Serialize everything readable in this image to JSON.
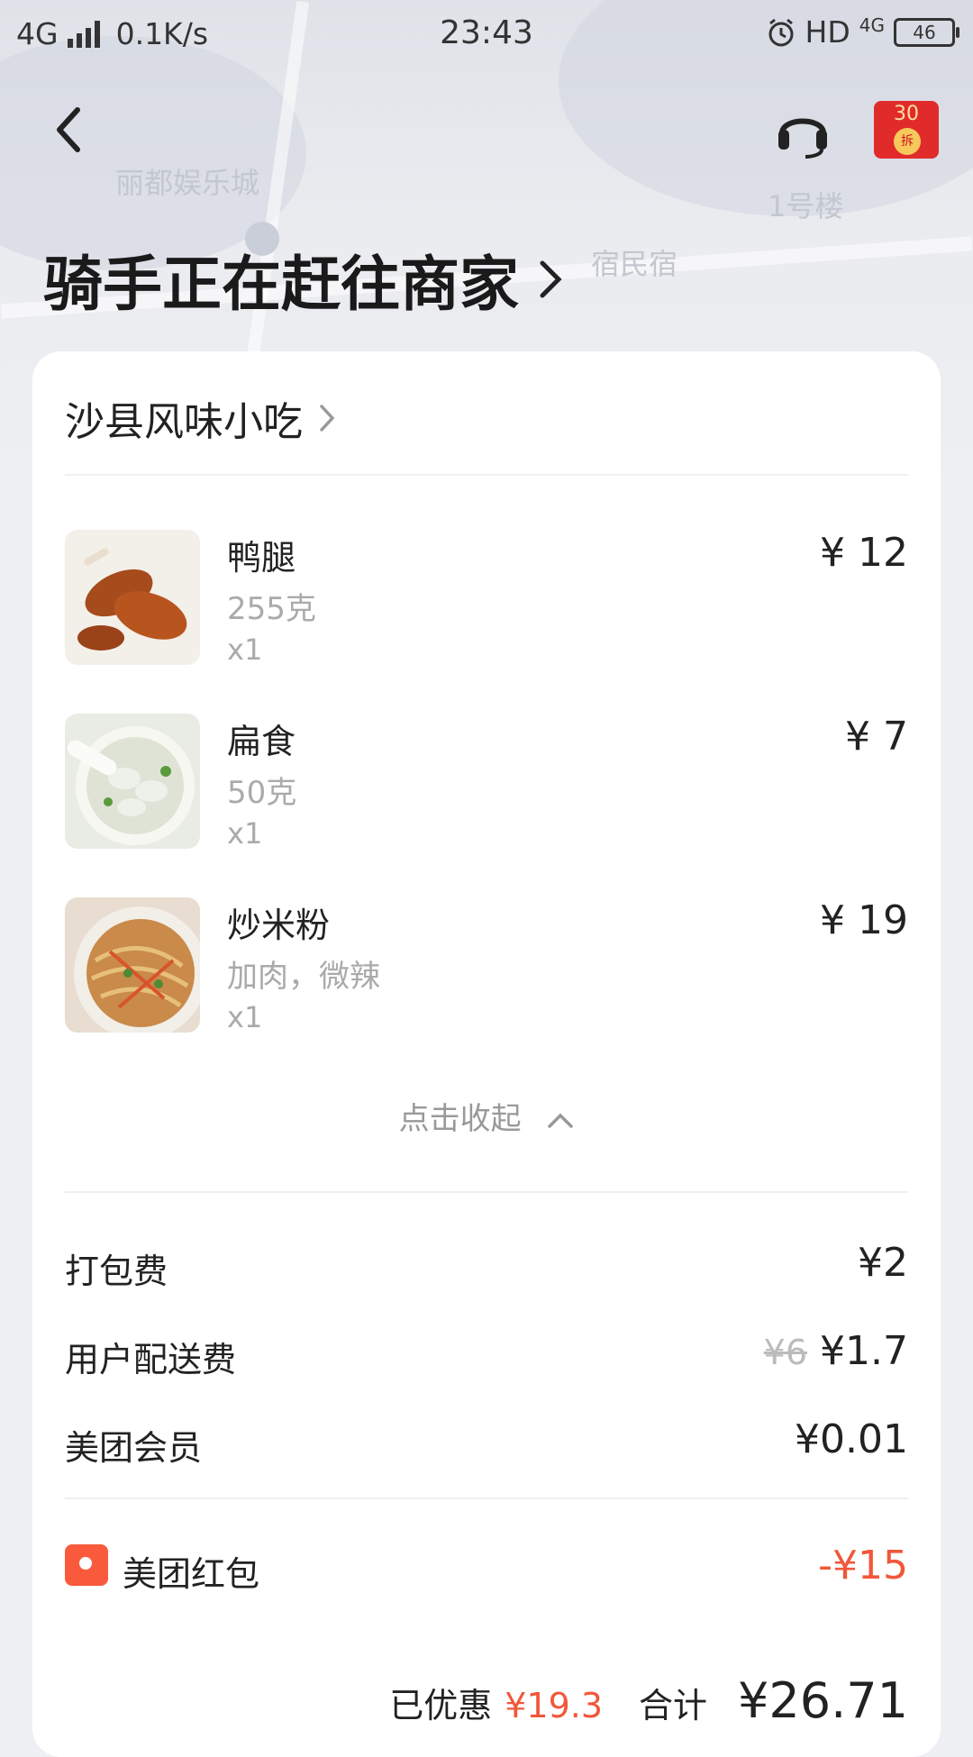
{
  "status_bar": {
    "network": "4G",
    "speed": "0.1K/s",
    "time": "23:43",
    "hd": "HD",
    "net_right": "4G",
    "battery": "46"
  },
  "header": {
    "back_icon": "chevron-left-icon",
    "service_icon": "headset-icon",
    "redpacket_amount": "30",
    "redpacket_badge": "拆"
  },
  "map": {
    "labels": [
      "丽都娱乐城",
      "1号楼",
      "宿民宿"
    ]
  },
  "order_status": "骑手正在赶往商家",
  "shop": {
    "name": "沙县风味小吃"
  },
  "items": [
    {
      "name": "鸭腿",
      "spec": "255克",
      "qty": "x1",
      "price": "¥ 12"
    },
    {
      "name": "扁食",
      "spec": "50克",
      "qty": "x1",
      "price": "¥ 7"
    },
    {
      "name": "炒米粉",
      "spec": "加肉，微辣",
      "qty": "x1",
      "price": "¥ 19"
    }
  ],
  "collapse_label": "点击收起",
  "fees": {
    "packing": {
      "label": "打包费",
      "value": "¥2"
    },
    "delivery": {
      "label": "用户配送费",
      "original": "¥6",
      "value": "¥1.7"
    },
    "member": {
      "label": "美团会员",
      "value": "¥0.01"
    }
  },
  "red_packet": {
    "label": "美团红包",
    "value": "-¥15"
  },
  "summary": {
    "discount_label": "已优惠",
    "discount_value": "¥19.3",
    "total_label": "合计",
    "total_value": "¥26.71"
  },
  "colors": {
    "accent": "#f1573a",
    "redpacket": "#e12b2b"
  }
}
